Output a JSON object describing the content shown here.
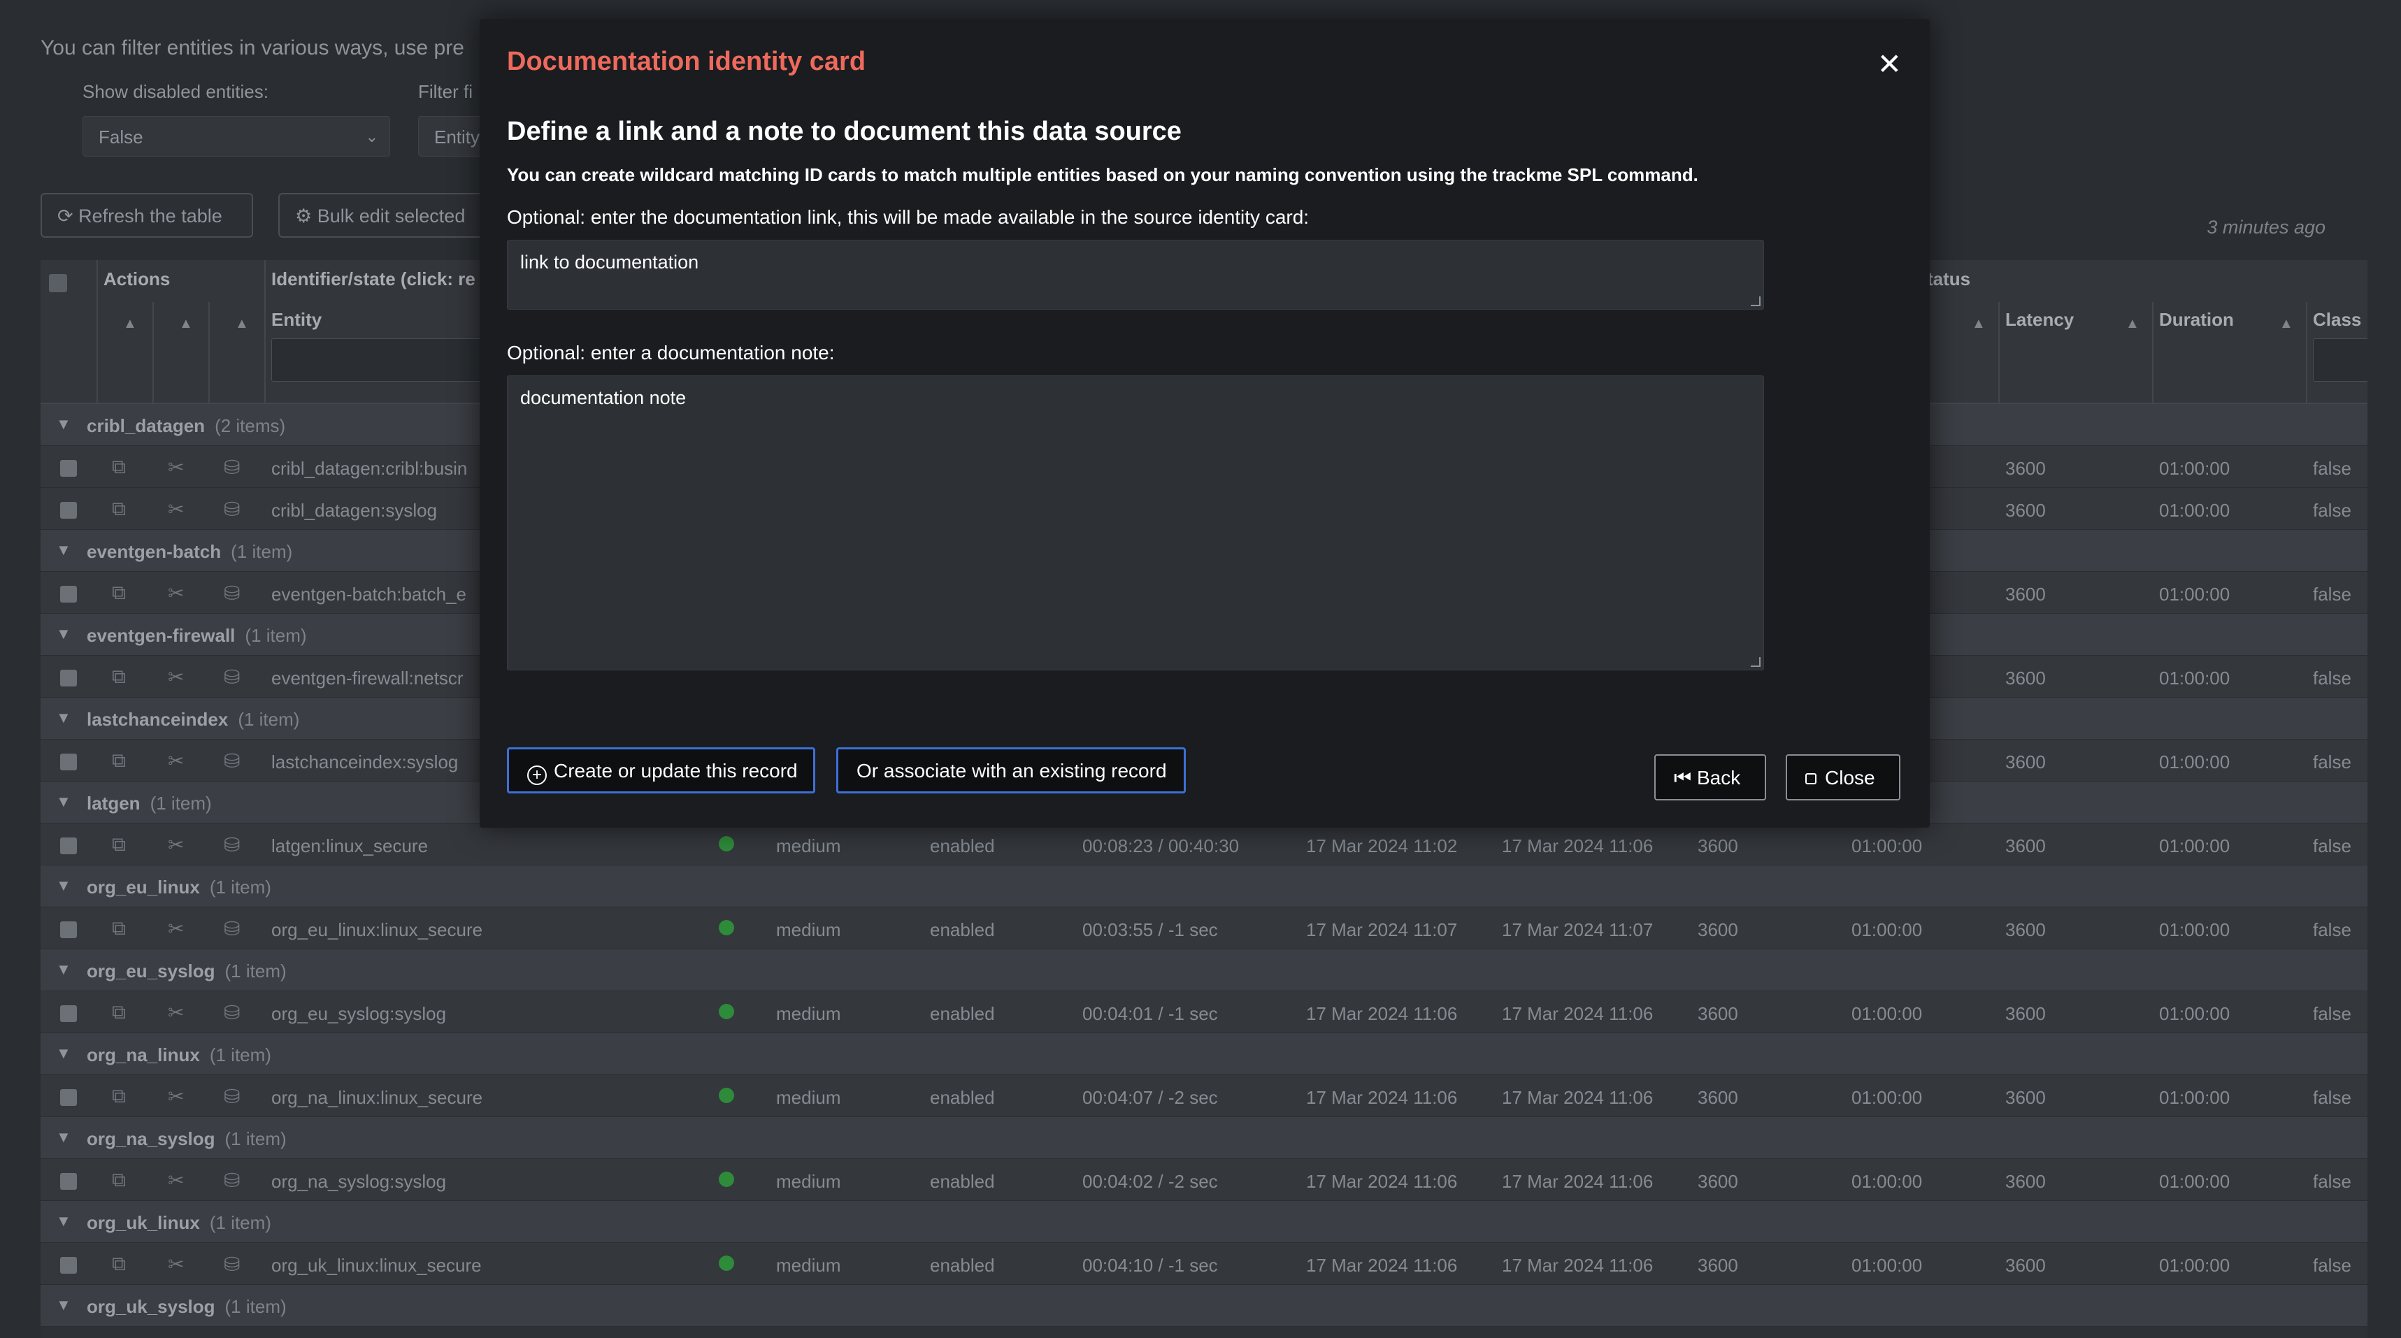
{
  "background": {
    "intro": "You can filter entities in various ways, use pre",
    "filter_disabled_label": "Show disabled entities:",
    "filter_disabled_value": "False",
    "filter_field_label": "Filter fi",
    "filter_field_value": "Entity",
    "refresh_label": "Refresh the table",
    "bulk_label": "Bulk edit selected",
    "updated": "3 minutes ago",
    "headers": {
      "actions": "Actions",
      "identifier": "Identifier/state (click: re",
      "entity": "Entity",
      "status": "tatus",
      "latency": "Latency",
      "duration": "Duration",
      "class": "Class"
    },
    "groups": [
      {
        "name": "cribl_datagen",
        "count": "(2 items)",
        "rows": [
          {
            "entity": "cribl_datagen:cribl:busin",
            "latency": "3600",
            "duration": "01:00:00",
            "class": "false"
          },
          {
            "entity": "cribl_datagen:syslog",
            "latency": "3600",
            "duration": "01:00:00",
            "class": "false"
          }
        ]
      },
      {
        "name": "eventgen-batch",
        "count": "(1 item)",
        "rows": [
          {
            "entity": "eventgen-batch:batch_e",
            "latency": "3600",
            "duration": "01:00:00",
            "class": "false"
          }
        ]
      },
      {
        "name": "eventgen-firewall",
        "count": "(1 item)",
        "rows": [
          {
            "entity": "eventgen-firewall:netscr",
            "latency": "3600",
            "duration": "01:00:00",
            "class": "false"
          }
        ]
      },
      {
        "name": "lastchanceindex",
        "count": "(1 item)",
        "rows": [
          {
            "entity": "lastchanceindex:syslog",
            "latency": "3600",
            "duration": "01:00:00",
            "class": "false"
          }
        ]
      },
      {
        "name": "latgen",
        "count": "(1 item)",
        "rows": [
          {
            "entity": "latgen:linux_secure",
            "priority": "medium",
            "state": "enabled",
            "lag": "00:08:23 / 00:40:30",
            "first": "17 Mar 2024 11:02",
            "last": "17 Mar 2024 11:06",
            "max": "3600",
            "max_dur": "01:00:00",
            "latency": "3600",
            "duration": "01:00:00",
            "class": "false"
          }
        ]
      },
      {
        "name": "org_eu_linux",
        "count": "(1 item)",
        "rows": [
          {
            "entity": "org_eu_linux:linux_secure",
            "priority": "medium",
            "state": "enabled",
            "lag": "00:03:55 / -1 sec",
            "first": "17 Mar 2024 11:07",
            "last": "17 Mar 2024 11:07",
            "max": "3600",
            "max_dur": "01:00:00",
            "latency": "3600",
            "duration": "01:00:00",
            "class": "false"
          }
        ]
      },
      {
        "name": "org_eu_syslog",
        "count": "(1 item)",
        "rows": [
          {
            "entity": "org_eu_syslog:syslog",
            "priority": "medium",
            "state": "enabled",
            "lag": "00:04:01 / -1 sec",
            "first": "17 Mar 2024 11:06",
            "last": "17 Mar 2024 11:06",
            "max": "3600",
            "max_dur": "01:00:00",
            "latency": "3600",
            "duration": "01:00:00",
            "class": "false"
          }
        ]
      },
      {
        "name": "org_na_linux",
        "count": "(1 item)",
        "rows": [
          {
            "entity": "org_na_linux:linux_secure",
            "priority": "medium",
            "state": "enabled",
            "lag": "00:04:07 / -2 sec",
            "first": "17 Mar 2024 11:06",
            "last": "17 Mar 2024 11:06",
            "max": "3600",
            "max_dur": "01:00:00",
            "latency": "3600",
            "duration": "01:00:00",
            "class": "false"
          }
        ]
      },
      {
        "name": "org_na_syslog",
        "count": "(1 item)",
        "rows": [
          {
            "entity": "org_na_syslog:syslog",
            "priority": "medium",
            "state": "enabled",
            "lag": "00:04:02 / -2 sec",
            "first": "17 Mar 2024 11:06",
            "last": "17 Mar 2024 11:06",
            "max": "3600",
            "max_dur": "01:00:00",
            "latency": "3600",
            "duration": "01:00:00",
            "class": "false"
          }
        ]
      },
      {
        "name": "org_uk_linux",
        "count": "(1 item)",
        "rows": [
          {
            "entity": "org_uk_linux:linux_secure",
            "priority": "medium",
            "state": "enabled",
            "lag": "00:04:10 / -1 sec",
            "first": "17 Mar 2024 11:06",
            "last": "17 Mar 2024 11:06",
            "max": "3600",
            "max_dur": "01:00:00",
            "latency": "3600",
            "duration": "01:00:00",
            "class": "false"
          }
        ]
      },
      {
        "name": "org_uk_syslog",
        "count": "(1 item)",
        "rows": []
      }
    ]
  },
  "modal": {
    "title": "Documentation identity card",
    "heading": "Define a link and a note to document this data source",
    "subheading": "You can create wildcard matching ID cards to match multiple entities based on your naming convention using the trackme SPL command.",
    "link_label": "Optional: enter the documentation link, this will be made available in the source identity card:",
    "link_value": "link to documentation",
    "note_label": "Optional: enter a documentation note:",
    "note_value": "documentation note",
    "create_label": "Create or update this record",
    "associate_label": "Or associate with an existing record",
    "back_label": "Back",
    "close_label": "Close"
  },
  "colors": {
    "title": "#ee6a5c",
    "primary_border": "#3d6fd6",
    "status_ok": "#2e8b3a"
  }
}
